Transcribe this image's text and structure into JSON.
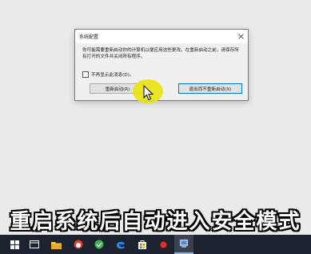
{
  "dialog": {
    "title": "系统配置",
    "message": "你可能需要重新启动你的计算机以便应用这些更改。在重新启动之前，请保存所有打开的文件并关闭所有程序。",
    "checkbox_label": "不再显示此消息(D)。",
    "checkbox_checked": false,
    "restart_button": "重新启动(R)",
    "exit_button": "退出而不重新启动(X)"
  },
  "caption": "重启系统后自动进入安全模式",
  "taskbar": {
    "items": [
      {
        "name": "start-icon"
      },
      {
        "name": "task-view-icon"
      },
      {
        "name": "file-explorer-icon"
      },
      {
        "name": "fox-app-icon"
      },
      {
        "name": "green-app-icon"
      },
      {
        "name": "edge-icon"
      },
      {
        "name": "store-icon"
      },
      {
        "name": "record-icon"
      },
      {
        "name": "system-config-icon"
      }
    ]
  },
  "colors": {
    "desktop": "#eaeaea",
    "taskbar": "#1c2230",
    "highlight": "#e8e414",
    "accent": "#0078d7"
  }
}
